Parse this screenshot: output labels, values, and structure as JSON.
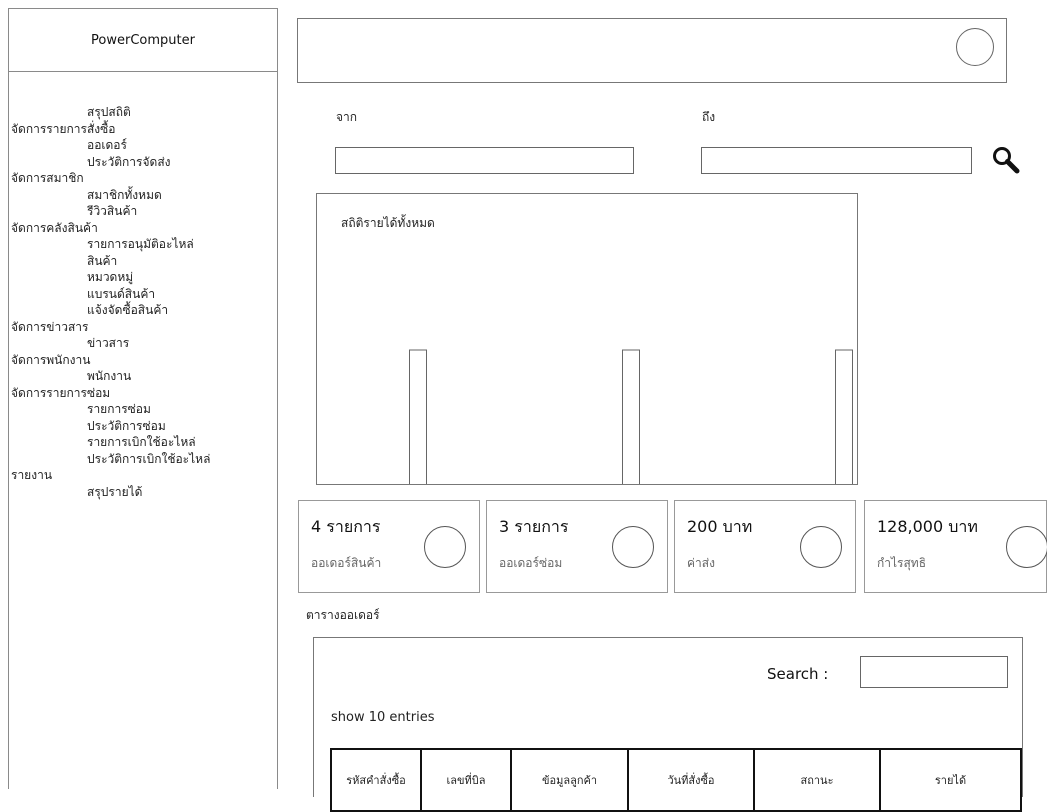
{
  "sidebar": {
    "brand": "PowerComputer",
    "items": [
      {
        "label": "สรุปสถิติ",
        "level": "sub"
      },
      {
        "label": "จัดการรายการสั่งซื้อ",
        "level": "group"
      },
      {
        "label": "ออเดอร์",
        "level": "sub"
      },
      {
        "label": "ประวัติการจัดส่ง",
        "level": "sub"
      },
      {
        "label": "จัดการสมาชิก",
        "level": "group"
      },
      {
        "label": "สมาชิกทั้งหมด",
        "level": "sub"
      },
      {
        "label": "รีวิวสินค้า",
        "level": "sub"
      },
      {
        "label": "จัดการคลังสินค้า",
        "level": "group"
      },
      {
        "label": "รายการอนุมัติอะไหล่",
        "level": "sub"
      },
      {
        "label": "สินค้า",
        "level": "sub"
      },
      {
        "label": "หมวดหมู่",
        "level": "sub"
      },
      {
        "label": "แบรนด์สินค้า",
        "level": "sub"
      },
      {
        "label": "แจ้งจัดซื้อสินค้า",
        "level": "sub"
      },
      {
        "label": "จัดการข่าวสาร",
        "level": "group"
      },
      {
        "label": "ข่าวสาร",
        "level": "sub"
      },
      {
        "label": "จัดการพนักงาน",
        "level": "group"
      },
      {
        "label": "พนักงาน",
        "level": "sub"
      },
      {
        "label": "จัดการรายการซ่อม",
        "level": "group"
      },
      {
        "label": "รายการซ่อม",
        "level": "sub"
      },
      {
        "label": "ประวัติการซ่อม",
        "level": "sub"
      },
      {
        "label": "รายการเบิกใช้อะไหล่",
        "level": "sub"
      },
      {
        "label": "ประวัติการเบิกใช้อะไหล่",
        "level": "sub"
      },
      {
        "label": "รายงาน",
        "level": "group"
      },
      {
        "label": "สรุปรายได้",
        "level": "sub"
      }
    ]
  },
  "filters": {
    "from_label": "จาก",
    "to_label": "ถึง",
    "from_value": "",
    "to_value": ""
  },
  "chart_data": {
    "type": "bar",
    "title": "สถิติรายได้ทั้งหมด",
    "categories": [
      "",
      "",
      ""
    ],
    "values": [
      1,
      1,
      1
    ],
    "xlabel": "",
    "ylabel": "",
    "grid": false
  },
  "cards": [
    {
      "value": "4 รายการ",
      "caption": "ออเดอร์สินค้า"
    },
    {
      "value": "3 รายการ",
      "caption": "ออเดอร์ซ่อม"
    },
    {
      "value": "200 บาท",
      "caption": "ค่าส่ง"
    },
    {
      "value": "128,000 บาท",
      "caption": "กำไรสุทธิ"
    }
  ],
  "orders": {
    "heading": "ตารางออเดอร์",
    "search_label": "Search :",
    "search_value": "",
    "show_entries": "show  10 entries",
    "columns": [
      "รหัสคำสั่งซื้อ",
      "เลขที่บิล",
      "ข้อมูลลูกค้า",
      "วันที่สั่งซื้อ",
      "สถานะ",
      "รายได้"
    ]
  },
  "colors": {
    "border": "#777777",
    "text": "#222222",
    "muted": "#666666"
  }
}
